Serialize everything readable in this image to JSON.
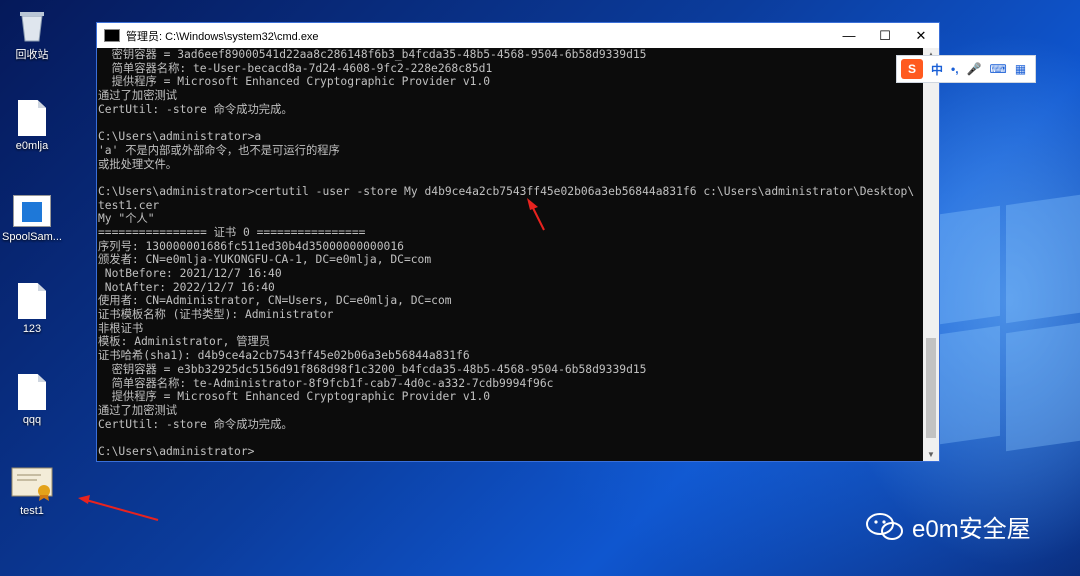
{
  "desktop": {
    "icons": [
      {
        "label": "回收站",
        "icon": "recycle-bin-icon"
      },
      {
        "label": "e0mlja",
        "icon": "document-icon"
      },
      {
        "label": "SpoolSam...",
        "icon": "window-app-icon"
      },
      {
        "label": "123",
        "icon": "document-icon"
      },
      {
        "label": "qqq",
        "icon": "document-icon"
      },
      {
        "label": "test1",
        "icon": "certificate-icon"
      }
    ]
  },
  "cmd": {
    "title": "管理员: C:\\Windows\\system32\\cmd.exe",
    "lines": [
      "  密钥容器 = 3ad6eef89000541d22aa8c286148f6b3_b4fcda35-48b5-4568-9504-6b58d9339d15",
      "  简单容器名称: te-User-becacd8a-7d24-4608-9fc2-228e268c85d1",
      "  提供程序 = Microsoft Enhanced Cryptographic Provider v1.0",
      "通过了加密测试",
      "CertUtil: -store 命令成功完成。",
      "",
      "C:\\Users\\administrator>a",
      "'a' 不是内部或外部命令，也不是可运行的程序",
      "或批处理文件。",
      "",
      "C:\\Users\\administrator>certutil -user -store My d4b9ce4a2cb7543ff45e02b06a3eb56844a831f6 c:\\Users\\administrator\\Desktop\\",
      "test1.cer",
      "My \"个人\"",
      "================ 证书 0 ================",
      "序列号: 130000001686fc511ed30b4d35000000000016",
      "颁发者: CN=e0mlja-YUKONGFU-CA-1, DC=e0mlja, DC=com",
      " NotBefore: 2021/12/7 16:40",
      " NotAfter: 2022/12/7 16:40",
      "使用者: CN=Administrator, CN=Users, DC=e0mlja, DC=com",
      "证书模板名称 (证书类型): Administrator",
      "非根证书",
      "模板: Administrator, 管理员",
      "证书哈希(sha1): d4b9ce4a2cb7543ff45e02b06a3eb56844a831f6",
      "  密钥容器 = e3bb32925dc5156d91f868d98f1c3200_b4fcda35-48b5-4568-9504-6b58d9339d15",
      "  简单容器名称: te-Administrator-8f9fcb1f-cab7-4d0c-a332-7cdb9994f96c",
      "  提供程序 = Microsoft Enhanced Cryptographic Provider v1.0",
      "通过了加密测试",
      "CertUtil: -store 命令成功完成。",
      "",
      "C:\\Users\\administrator>"
    ]
  },
  "ime": {
    "logo": "S",
    "mode": "中",
    "punct": "•,"
  },
  "watermark": {
    "text": "e0m安全屋"
  },
  "colors": {
    "arrow": "#e8231f",
    "console_text": "#c0c0c0"
  }
}
